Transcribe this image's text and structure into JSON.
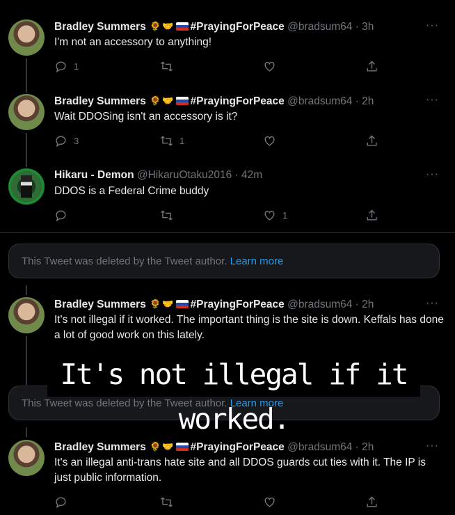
{
  "tweets": [
    {
      "name": "Bradley Summers",
      "tag": "#PrayingForPeace",
      "handle": "@bradsum64",
      "time": "· 3h",
      "text": "I'm not an accessory to anything!",
      "reply_count": "1",
      "retweet_count": "",
      "like_count": ""
    },
    {
      "name": "Bradley Summers",
      "tag": "#PrayingForPeace",
      "handle": "@bradsum64",
      "time": "· 2h",
      "text": "Wait DDOSing isn't an accessory is it?",
      "reply_count": "3",
      "retweet_count": "1",
      "like_count": ""
    },
    {
      "name": "Hikaru - Demon",
      "handle": "@HikaruOtaku2016",
      "time": "· 42m",
      "text": "DDOS is a Federal Crime buddy",
      "reply_count": "",
      "retweet_count": "",
      "like_count": "1"
    },
    {
      "name": "Bradley Summers",
      "tag": "#PrayingForPeace",
      "handle": "@bradsum64",
      "time": "· 2h",
      "text": "It's not illegal if it worked. The important thing is the site is down. Keffals has done a lot of good work on this lately."
    },
    {
      "name": "Bradley Summers",
      "tag": "#PrayingForPeace",
      "handle": "@bradsum64",
      "time": "· 2h",
      "text": "It's an illegal anti-trans hate site and all DDOS guards cut ties with it. The IP is just public information."
    }
  ],
  "deleted_notice": {
    "text": "This Tweet was deleted by the Tweet author.",
    "link": "Learn more"
  },
  "overlay_caption": "It's not illegal if it worked.",
  "more_glyph": "···",
  "colors": {
    "background": "#000000",
    "text": "#e7e9ea",
    "muted": "#71767b",
    "link": "#1d9bf0"
  },
  "icons": [
    "reply-icon",
    "retweet-icon",
    "like-icon",
    "share-icon",
    "more-icon"
  ]
}
